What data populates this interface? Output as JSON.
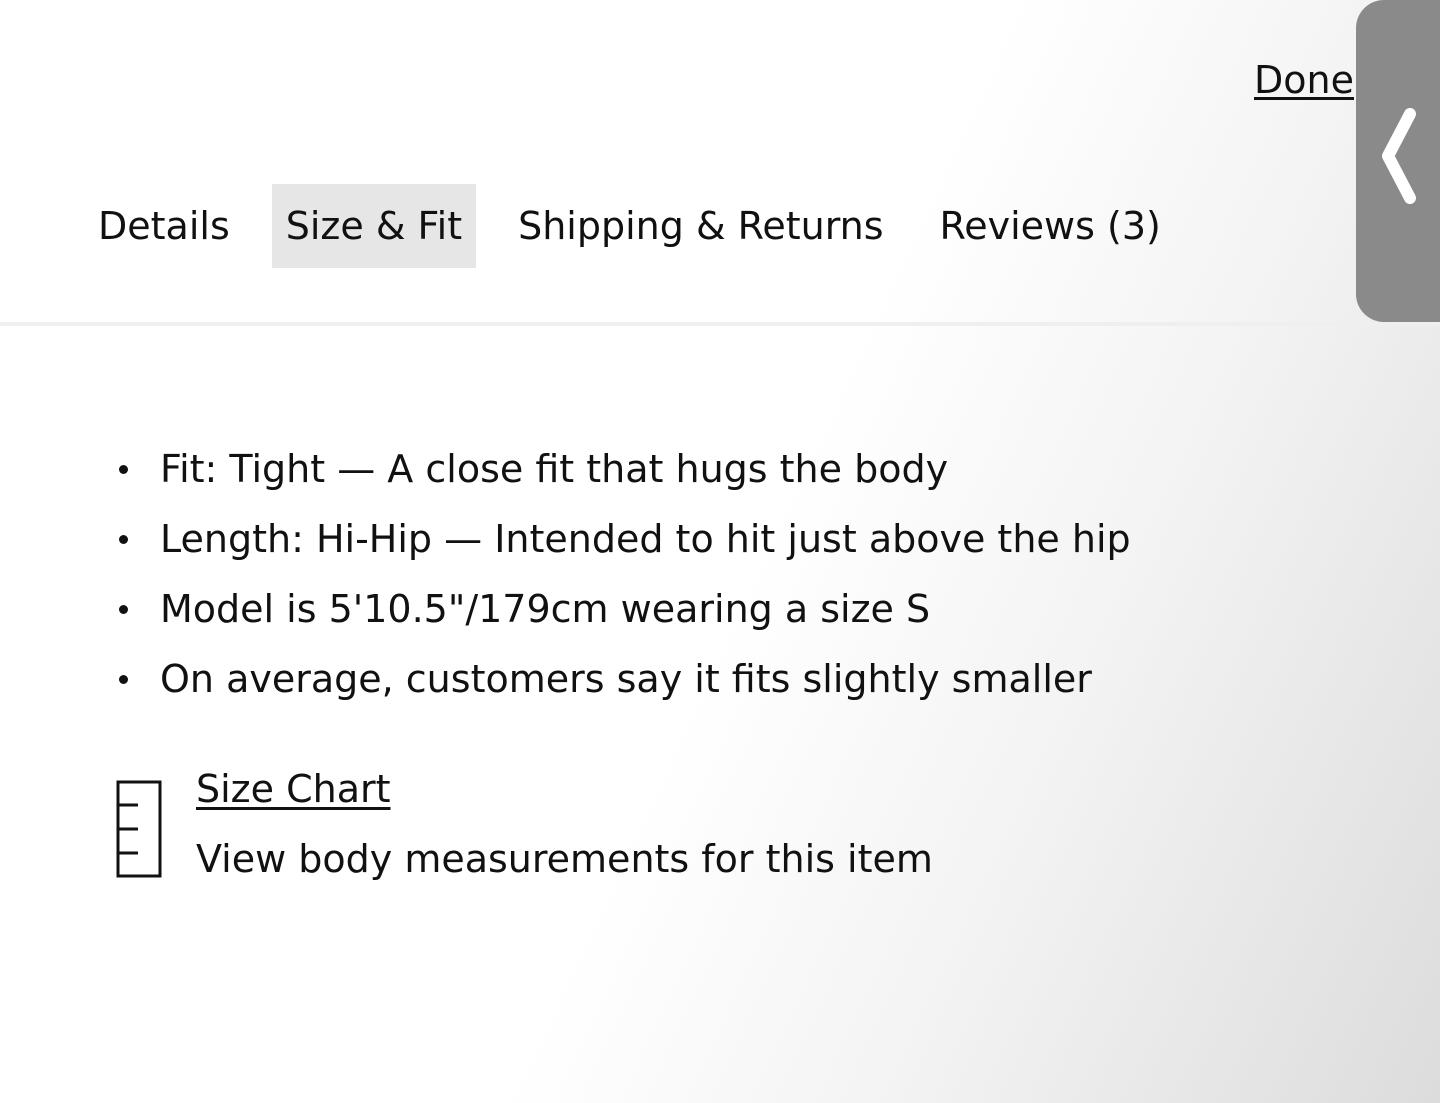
{
  "header": {
    "done_label": "Done",
    "tabs": [
      {
        "label": "Details",
        "active": false
      },
      {
        "label": "Size & Fit",
        "active": true
      },
      {
        "label": "Shipping & Returns",
        "active": false
      },
      {
        "label": "Reviews (3)",
        "active": false
      }
    ]
  },
  "side_handle": {
    "icon": "chevron-left-icon",
    "color": "#8a8a8a"
  },
  "fit_details": [
    "Fit: Tight — A close fit that hugs the body",
    "Length: Hi-Hip — Intended to hit just above the hip",
    "Model is 5'10.5\"/179cm wearing a size S",
    "On average, customers say it fits slightly smaller"
  ],
  "size_chart": {
    "icon": "ruler-icon",
    "link_label": "Size Chart",
    "description": "View body measurements for this item"
  },
  "colors": {
    "text": "#111111",
    "active_tab_bg": "#e6e6e6",
    "divider": "#efefef"
  }
}
